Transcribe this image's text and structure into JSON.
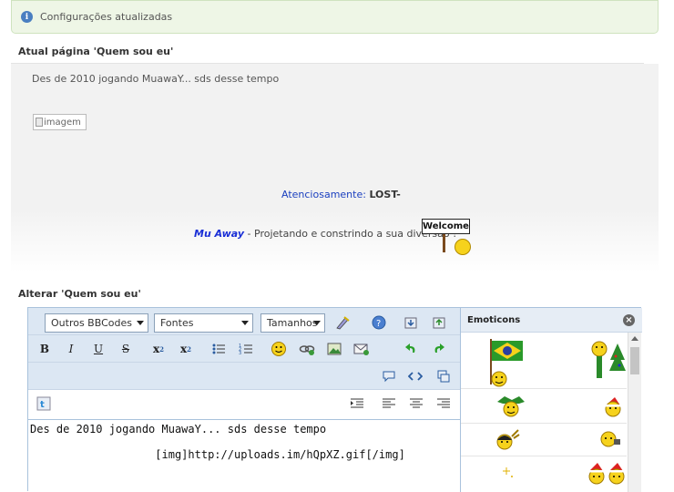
{
  "alert": {
    "message": "Configurações atualizadas",
    "icon": "info-icon"
  },
  "current_section": {
    "title": "Atual página 'Quem sou eu'"
  },
  "preview": {
    "line1": "Des de 2010 jogando MuawaY... sds desse tempo",
    "image_alt": "imagem",
    "regards_label": "Atenciosamente:",
    "regards_name": "LOST-",
    "brand": "Mu Away",
    "tagline": " - Projetando e constrindo a sua diversão ! ",
    "welcome_sign": "Welcome"
  },
  "edit_section": {
    "title": "Alterar 'Quem sou eu'"
  },
  "editor": {
    "selects": {
      "bbcodes": "Outros BBCodes",
      "fonts": "Fontes",
      "sizes": "Tamanhos"
    },
    "buttons": {
      "bold": "B",
      "italic": "I",
      "underline": "U",
      "strike": "S",
      "subscript": "x",
      "superscript": "x"
    },
    "content": "Des de 2010 jogando MuawaY... sds desse tempo\n\n                   [img]http://uploads.im/hQpXZ.gif[/img]"
  },
  "emoticons": {
    "title": "Emoticons"
  },
  "colors": {
    "accent": "#1a3fbf",
    "brand": "#1a2fd6",
    "toolbar": "#dce7f3",
    "alert_bg": "#eef6e6"
  }
}
